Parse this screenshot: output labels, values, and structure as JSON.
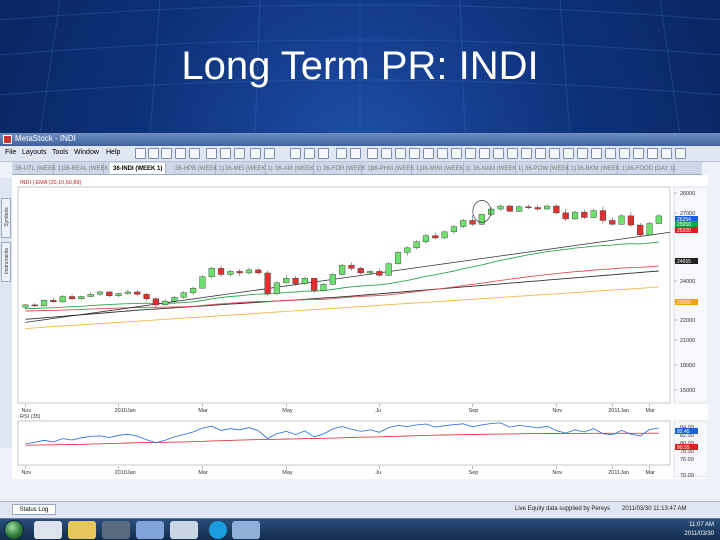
{
  "slide": {
    "title": "Long Term PR: INDI"
  },
  "window": {
    "title": "MetaStock - INDI"
  },
  "menu": {
    "items": [
      "File",
      "Layouts",
      "Tools",
      "Window",
      "Help"
    ]
  },
  "tabs": [
    "36-UTL (WEEK 1)",
    "36-REAL (WEEK 1)",
    "36-INDI (WEEK 1)",
    "36-HPB (WEEK 1)",
    "36-MEI (WEEK 1)",
    "36-AM (WEEK 1)",
    "36-FOR (WEEK 1)",
    "36-PHM (WEEK 1)",
    "36-MINI (WEEK 1)",
    "36-NAM (WEEK 1)",
    "36-POW (WEEK 1)",
    "36-BKM (WEEK 1)",
    "36-FOOD (DAY 1)"
  ],
  "active_tab_index": 2,
  "side_tabs": [
    "Symbols",
    "Instruments"
  ],
  "price_panel": {
    "label": "INDI | EMA (20,10,50,89)"
  },
  "rsi_panel": {
    "label": "RSI (35)"
  },
  "price_axis": {
    "ticks": [
      "26000",
      "27000",
      "26500",
      "25000",
      "24000",
      "23000",
      "22000",
      "21000",
      "18000",
      "15000"
    ],
    "badges": [
      {
        "text": "26254",
        "color": "#1b5fd6"
      },
      {
        "text": "25950",
        "color": "#18a34a"
      },
      {
        "text": "25200",
        "color": "#d92020"
      },
      {
        "text": "24655",
        "color": "#222222"
      },
      {
        "text": "23000",
        "color": "#f2a300"
      }
    ]
  },
  "rsi_axis": {
    "ticks": [
      "84.00",
      "82.00",
      "80.00",
      "78.00",
      "76.00",
      "70.00"
    ],
    "badges": [
      {
        "text": "82.45",
        "color": "#1b5fd6"
      },
      {
        "text": "80.55",
        "color": "#d92020"
      }
    ]
  },
  "time_axis": [
    "Nov",
    "2010Jan",
    "Mar",
    "May",
    "Ju",
    "Sep",
    "Nov",
    "2011Jan",
    "Mar"
  ],
  "chart_data": {
    "type": "candlestick",
    "candles": [
      [
        20300,
        20500,
        20150,
        20450
      ],
      [
        20450,
        20550,
        20300,
        20380
      ],
      [
        20380,
        20800,
        20350,
        20750
      ],
      [
        20750,
        20900,
        20600,
        20650
      ],
      [
        20650,
        21100,
        20600,
        21000
      ],
      [
        21000,
        21150,
        20750,
        20850
      ],
      [
        20850,
        21050,
        20750,
        21000
      ],
      [
        21000,
        21300,
        20950,
        21150
      ],
      [
        21150,
        21400,
        21050,
        21300
      ],
      [
        21300,
        21350,
        20950,
        21050
      ],
      [
        21050,
        21250,
        20950,
        21200
      ],
      [
        21200,
        21450,
        21100,
        21300
      ],
      [
        21300,
        21400,
        21050,
        21150
      ],
      [
        21150,
        21250,
        20700,
        20850
      ],
      [
        20850,
        20950,
        20300,
        20450
      ],
      [
        20450,
        20800,
        20400,
        20700
      ],
      [
        20700,
        21050,
        20550,
        20950
      ],
      [
        20950,
        21350,
        20850,
        21250
      ],
      [
        21250,
        21650,
        21100,
        21550
      ],
      [
        21550,
        22400,
        21500,
        22300
      ],
      [
        22300,
        22950,
        22200,
        22850
      ],
      [
        22850,
        23050,
        22300,
        22450
      ],
      [
        22450,
        22750,
        22300,
        22650
      ],
      [
        22650,
        22800,
        22350,
        22550
      ],
      [
        22550,
        22900,
        22450,
        22750
      ],
      [
        22750,
        22850,
        22450,
        22550
      ],
      [
        22550,
        22700,
        21050,
        21200
      ],
      [
        21200,
        22000,
        21100,
        21900
      ],
      [
        21900,
        22400,
        21850,
        22200
      ],
      [
        22200,
        22350,
        21700,
        21850
      ],
      [
        21850,
        22300,
        21750,
        22200
      ],
      [
        22200,
        22250,
        21250,
        21400
      ],
      [
        21400,
        21900,
        21350,
        21800
      ],
      [
        21800,
        22550,
        21750,
        22450
      ],
      [
        22450,
        23150,
        22400,
        23050
      ],
      [
        23050,
        23250,
        22700,
        22850
      ],
      [
        22850,
        22950,
        22450,
        22550
      ],
      [
        22550,
        22750,
        22400,
        22650
      ],
      [
        22650,
        22850,
        22300,
        22400
      ],
      [
        22400,
        23250,
        22350,
        23150
      ],
      [
        23150,
        24000,
        23100,
        23900
      ],
      [
        23900,
        24300,
        23700,
        24200
      ],
      [
        24200,
        24700,
        24100,
        24600
      ],
      [
        24600,
        25100,
        24500,
        25000
      ],
      [
        25000,
        25200,
        24750,
        24850
      ],
      [
        24850,
        25350,
        24800,
        25250
      ],
      [
        25250,
        25700,
        25150,
        25600
      ],
      [
        25600,
        26100,
        25500,
        26000
      ],
      [
        26000,
        26350,
        25650,
        25750
      ],
      [
        25750,
        26450,
        25700,
        26400
      ],
      [
        26400,
        26850,
        26300,
        26750
      ],
      [
        26750,
        27050,
        26650,
        26950
      ],
      [
        26950,
        27050,
        26550,
        26600
      ],
      [
        26600,
        27000,
        26550,
        26900
      ],
      [
        26900,
        27050,
        26750,
        26850
      ],
      [
        26850,
        27000,
        26650,
        26750
      ],
      [
        26750,
        27050,
        26700,
        26950
      ],
      [
        26950,
        27050,
        26400,
        26500
      ],
      [
        26500,
        26750,
        25950,
        26100
      ],
      [
        26100,
        26650,
        26050,
        26550
      ],
      [
        26550,
        26700,
        26100,
        26200
      ],
      [
        26200,
        26750,
        26150,
        26650
      ],
      [
        26650,
        26900,
        25800,
        26000
      ],
      [
        26000,
        26200,
        25650,
        25750
      ],
      [
        25750,
        26400,
        25700,
        26300
      ],
      [
        26300,
        26550,
        25550,
        25700
      ],
      [
        25700,
        25850,
        24950,
        25050
      ],
      [
        25050,
        25900,
        25000,
        25800
      ],
      [
        25800,
        26400,
        25750,
        26300
      ]
    ],
    "ema_green": [
      20200,
      20210,
      20240,
      20260,
      20300,
      20330,
      20360,
      20400,
      20440,
      20470,
      20500,
      20530,
      20550,
      20560,
      20550,
      20550,
      20570,
      20600,
      20650,
      20740,
      20850,
      20930,
      21000,
      21050,
      21110,
      21160,
      21160,
      21210,
      21270,
      21300,
      21350,
      21360,
      21390,
      21460,
      21560,
      21640,
      21690,
      21740,
      21770,
      21840,
      21950,
      22060,
      22190,
      22330,
      22430,
      22550,
      22680,
      22830,
      22950,
      23080,
      23230,
      23380,
      23500,
      23620,
      23740,
      23840,
      23950,
      24030,
      24100,
      24180,
      24240,
      24310,
      24350,
      24380,
      24440,
      24470,
      24460,
      24510,
      24580
    ],
    "ema_red": [
      20050,
      20060,
      20080,
      20090,
      20110,
      20130,
      20150,
      20170,
      20200,
      20220,
      20240,
      20260,
      20280,
      20290,
      20290,
      20300,
      20310,
      20330,
      20360,
      20410,
      20470,
      20520,
      20560,
      20600,
      20640,
      20670,
      20680,
      20710,
      20740,
      20760,
      20790,
      20800,
      20820,
      20860,
      20920,
      20970,
      21010,
      21040,
      21070,
      21110,
      21180,
      21250,
      21320,
      21400,
      21470,
      21550,
      21630,
      21720,
      21800,
      21880,
      21970,
      22060,
      22140,
      22220,
      22300,
      22370,
      22440,
      22510,
      22570,
      22630,
      22680,
      22740,
      22780,
      22820,
      22870,
      22900,
      22920,
      22960,
      23010
    ],
    "sma_black": [
      19500,
      19550,
      19600,
      19650,
      19700,
      19750,
      19800,
      19850,
      19900,
      19950,
      20000,
      20050,
      20100,
      20140,
      20180,
      20220,
      20260,
      20300,
      20340,
      20380,
      20420,
      20460,
      20500,
      20540,
      20580,
      20620,
      20660,
      20700,
      20740,
      20780,
      20820,
      20860,
      20900,
      20940,
      20980,
      21030,
      21080,
      21130,
      21180,
      21230,
      21280,
      21330,
      21380,
      21430,
      21480,
      21530,
      21580,
      21630,
      21680,
      21730,
      21780,
      21830,
      21880,
      21930,
      21980,
      22030,
      22080,
      22130,
      22180,
      22230,
      22280,
      22330,
      22380,
      22430,
      22480,
      22530,
      22580,
      22630,
      22680
    ],
    "ema_orange": [
      18900,
      18940,
      18980,
      19020,
      19060,
      19100,
      19140,
      19180,
      19220,
      19260,
      19300,
      19340,
      19380,
      19420,
      19460,
      19500,
      19540,
      19580,
      19620,
      19660,
      19700,
      19740,
      19780,
      19820,
      19860,
      19900,
      19940,
      19980,
      20020,
      20060,
      20100,
      20140,
      20180,
      20220,
      20260,
      20300,
      20340,
      20380,
      20420,
      20460,
      20500,
      20540,
      20580,
      20620,
      20660,
      20700,
      20740,
      20780,
      20820,
      20860,
      20900,
      20940,
      20980,
      21020,
      21060,
      21100,
      21140,
      21180,
      21220,
      21260,
      21300,
      21340,
      21380,
      21420,
      21460,
      21500,
      21540,
      21580,
      21620
    ],
    "trendline": {
      "from": [
        0,
        19300
      ],
      "to": [
        68,
        24700
      ]
    },
    "rsi": [
      76.8,
      77.2,
      78.0,
      77.4,
      78.6,
      78.1,
      78.9,
      79.4,
      79.6,
      79.0,
      79.8,
      80.2,
      79.5,
      78.2,
      77.1,
      78.0,
      79.2,
      80.1,
      81.0,
      82.4,
      83.1,
      81.6,
      82.2,
      81.8,
      82.6,
      81.5,
      78.6,
      80.4,
      81.2,
      80.1,
      81.4,
      79.2,
      80.3,
      82.1,
      83.0,
      82.0,
      81.2,
      81.8,
      80.9,
      82.6,
      83.4,
      83.0,
      83.6,
      83.9,
      82.8,
      83.3,
      83.7,
      84.0,
      82.9,
      83.6,
      84.1,
      84.3,
      82.8,
      83.4,
      83.0,
      82.5,
      83.1,
      81.5,
      80.6,
      81.8,
      81.0,
      82.2,
      80.4,
      80.0,
      81.6,
      80.2,
      79.6,
      81.9,
      82.45
    ],
    "rsi_red": [
      76.2,
      76.25,
      76.3,
      76.35,
      76.4,
      76.45,
      76.5,
      76.6,
      76.7,
      76.8,
      76.9,
      77.0,
      77.1,
      77.2,
      77.2,
      77.25,
      77.3,
      77.4,
      77.5,
      77.6,
      77.75,
      77.85,
      77.95,
      78.05,
      78.15,
      78.25,
      78.3,
      78.35,
      78.45,
      78.5,
      78.6,
      78.65,
      78.7,
      78.8,
      78.9,
      79.0,
      79.1,
      79.15,
      79.25,
      79.35,
      79.45,
      79.55,
      79.65,
      79.75,
      79.85,
      79.9,
      80.0,
      80.05,
      80.1,
      80.15,
      80.2,
      80.25,
      80.3,
      80.35,
      80.4,
      80.4,
      80.45,
      80.45,
      80.5,
      80.5,
      80.5,
      80.52,
      80.52,
      80.53,
      80.53,
      80.54,
      80.54,
      80.55,
      80.55
    ],
    "price_range": [
      14000,
      28200
    ],
    "rsi_range": [
      69,
      85
    ],
    "colors": {
      "up": "#6ee06e",
      "down": "#e03030",
      "ema_green": "#2aa84a",
      "ema_red": "#e25050",
      "sma_black": "#333333",
      "ema_orange": "#f2b84a",
      "rsi": "#2a66e0",
      "rsi_red": "#e04040"
    }
  },
  "status": {
    "tab": "Status Log",
    "feed": "Live Equity data supplied by Pereys",
    "updated": "2011/03/30 11:13:47 AM"
  },
  "taskbar": {
    "time": "11:07 AM",
    "date": "2011/03/30"
  }
}
